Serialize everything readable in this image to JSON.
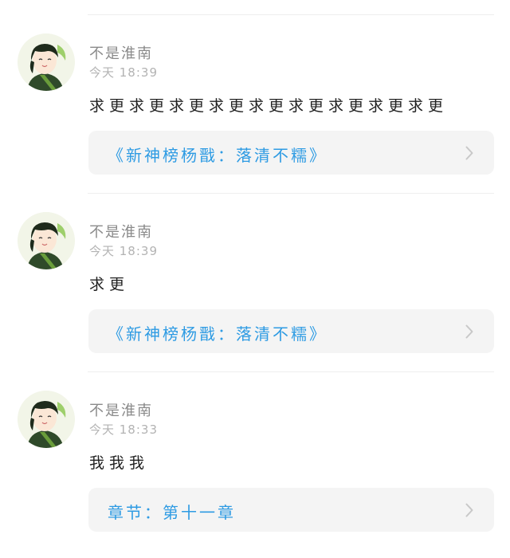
{
  "comments": [
    {
      "username": "不是淮南",
      "time": "今天 18:39",
      "text": "求更求更求更求更求更求更求更求更求更",
      "link": "《新神榜杨戬：落清不糯》"
    },
    {
      "username": "不是淮南",
      "time": "今天 18:39",
      "text": "求更",
      "link": "《新神榜杨戬：落清不糯》"
    },
    {
      "username": "不是淮南",
      "time": "今天 18:33",
      "text": "我我我",
      "link": "章节：第十一章"
    }
  ],
  "icons": {
    "avatar": "avatar-illustration",
    "link_arrow": "chevron-right-icon"
  },
  "colors": {
    "link": "#2e9be3",
    "card_bg": "#f4f4f4",
    "meta_text": "#b3b3b3",
    "username": "#8a8a8a"
  }
}
